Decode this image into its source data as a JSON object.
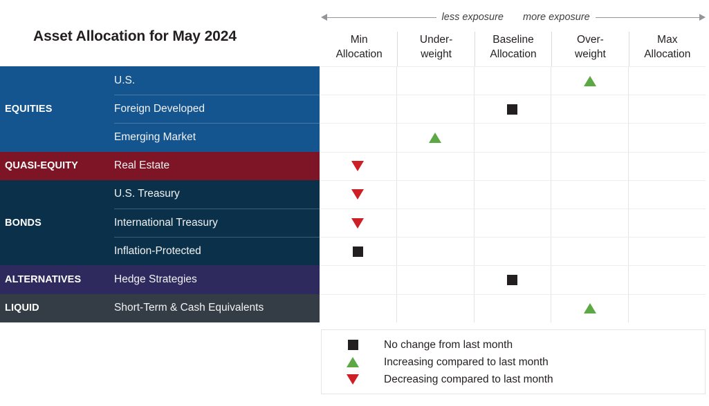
{
  "title": "Asset Allocation for May 2024",
  "axis": {
    "left_label": "less exposure",
    "right_label": "more exposure",
    "left_arrow_icon": "arrow-left-icon",
    "right_arrow_icon": "arrow-right-icon"
  },
  "colors": {
    "equities": "#14558f",
    "quasi_equity": "#7d1527",
    "bonds": "#0a3149",
    "alternatives": "#2e2a5e",
    "liquid": "#343d45",
    "no_change": "#231f20",
    "increasing": "#5ba845",
    "decreasing": "#cc1f26",
    "grid": "#e3e4e5",
    "axis_line": "#939598"
  },
  "columns": [
    {
      "line1": "Min",
      "line2": "Allocation"
    },
    {
      "line1": "Under-",
      "line2": "weight"
    },
    {
      "line1": "Baseline",
      "line2": "Allocation"
    },
    {
      "line1": "Over-",
      "line2": "weight"
    },
    {
      "line1": "Max",
      "line2": "Allocation"
    }
  ],
  "legend": [
    {
      "marker": "square",
      "icon": "square-icon",
      "label": "No change from last month"
    },
    {
      "marker": "up",
      "icon": "triangle-up-icon",
      "label": "Increasing compared to last month"
    },
    {
      "marker": "down",
      "icon": "triangle-down-icon",
      "label": "Decreasing compared to last month"
    }
  ],
  "groups": [
    {
      "label": "EQUITIES",
      "band_class": "band-equities",
      "rows": [
        {
          "label": "U.S.",
          "column": 3,
          "marker": "up"
        },
        {
          "label": "Foreign Developed",
          "column": 2,
          "marker": "square"
        },
        {
          "label": "Emerging Market",
          "column": 1,
          "marker": "up"
        }
      ]
    },
    {
      "label": "QUASI-EQUITY",
      "band_class": "band-quasi",
      "rows": [
        {
          "label": "Real Estate",
          "column": 0,
          "marker": "down"
        }
      ]
    },
    {
      "label": "BONDS",
      "band_class": "band-bonds",
      "rows": [
        {
          "label": "U.S. Treasury",
          "column": 0,
          "marker": "down"
        },
        {
          "label": "International Treasury",
          "column": 0,
          "marker": "down"
        },
        {
          "label": "Inflation-Protected",
          "column": 0,
          "marker": "square"
        }
      ]
    },
    {
      "label": "ALTERNATIVES",
      "band_class": "band-alternatives",
      "rows": [
        {
          "label": "Hedge Strategies",
          "column": 2,
          "marker": "square"
        }
      ]
    },
    {
      "label": "LIQUID",
      "band_class": "band-liquid",
      "rows": [
        {
          "label": "Short-Term & Cash Equivalents",
          "column": 3,
          "marker": "up"
        }
      ]
    }
  ],
  "chart_data": {
    "type": "table",
    "title": "Asset Allocation for May 2024",
    "xlabel": "",
    "ylabel": "",
    "grid": true,
    "legend_position": "bottom-right",
    "categories": [
      "Min Allocation",
      "Under-weight",
      "Baseline Allocation",
      "Over-weight",
      "Max Allocation"
    ],
    "axis_annotations": [
      "less exposure",
      "more exposure"
    ],
    "marker_meanings": {
      "square": "No change from last month",
      "up": "Increasing compared to last month",
      "down": "Decreasing compared to last month"
    },
    "rows": [
      {
        "group": "EQUITIES",
        "asset": "U.S.",
        "position": "Over-weight",
        "position_index": 3,
        "marker": "up",
        "change": "increasing"
      },
      {
        "group": "EQUITIES",
        "asset": "Foreign Developed",
        "position": "Baseline Allocation",
        "position_index": 2,
        "marker": "square",
        "change": "no change"
      },
      {
        "group": "EQUITIES",
        "asset": "Emerging Market",
        "position": "Under-weight",
        "position_index": 1,
        "marker": "up",
        "change": "increasing"
      },
      {
        "group": "QUASI-EQUITY",
        "asset": "Real Estate",
        "position": "Min Allocation",
        "position_index": 0,
        "marker": "down",
        "change": "decreasing"
      },
      {
        "group": "BONDS",
        "asset": "U.S. Treasury",
        "position": "Min Allocation",
        "position_index": 0,
        "marker": "down",
        "change": "decreasing"
      },
      {
        "group": "BONDS",
        "asset": "International Treasury",
        "position": "Min Allocation",
        "position_index": 0,
        "marker": "down",
        "change": "decreasing"
      },
      {
        "group": "BONDS",
        "asset": "Inflation-Protected",
        "position": "Min Allocation",
        "position_index": 0,
        "marker": "square",
        "change": "no change"
      },
      {
        "group": "ALTERNATIVES",
        "asset": "Hedge Strategies",
        "position": "Baseline Allocation",
        "position_index": 2,
        "marker": "square",
        "change": "no change"
      },
      {
        "group": "LIQUID",
        "asset": "Short-Term & Cash Equivalents",
        "position": "Over-weight",
        "position_index": 3,
        "marker": "up",
        "change": "increasing"
      }
    ]
  }
}
